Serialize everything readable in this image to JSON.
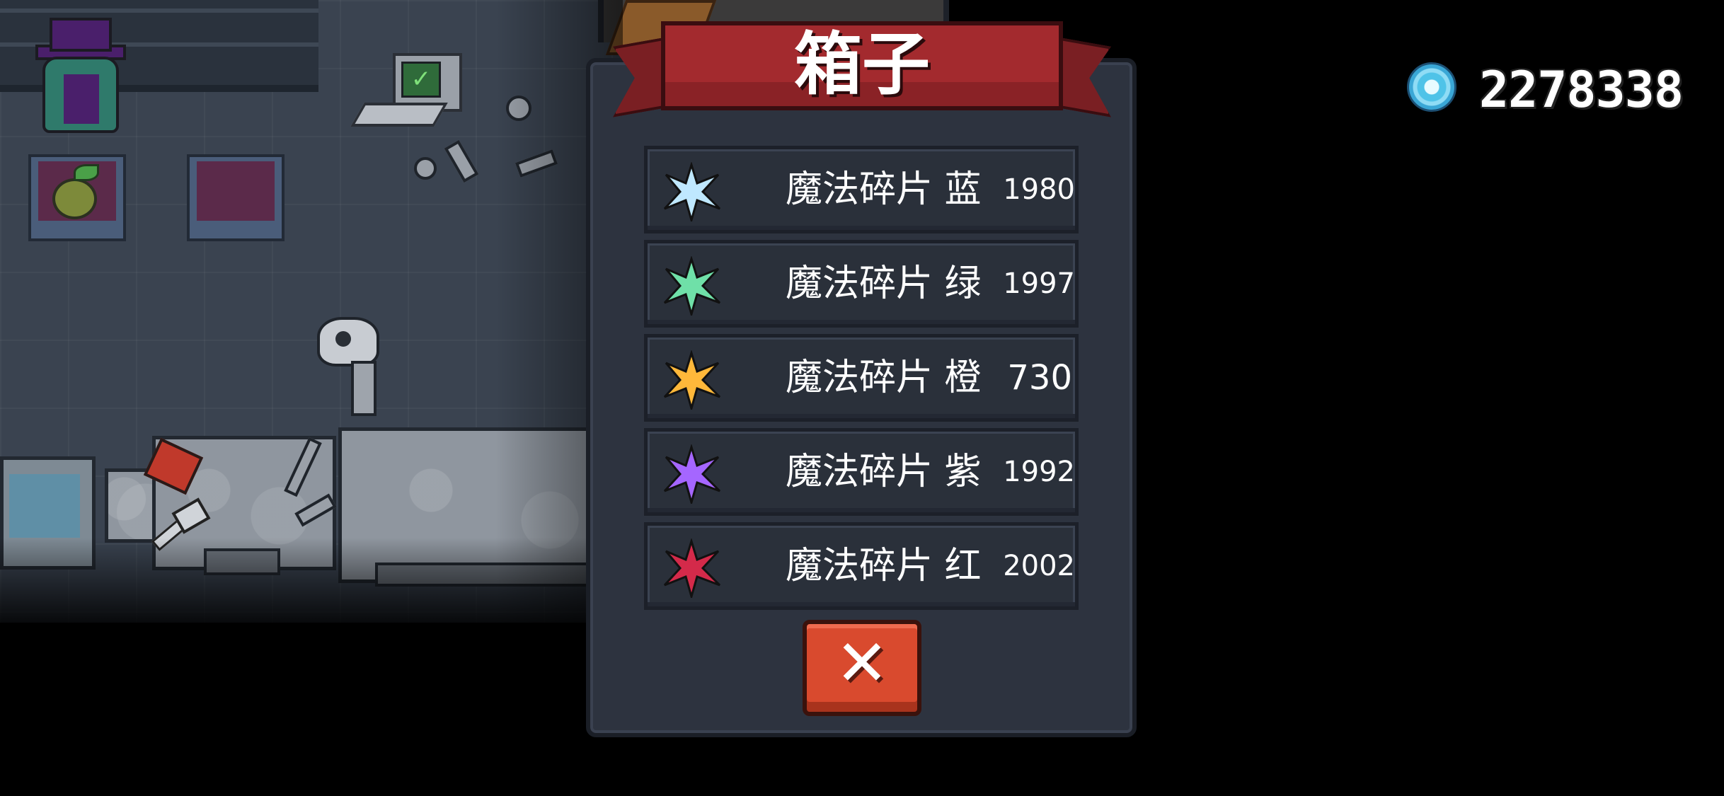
{
  "currency": {
    "icon": "gem-icon",
    "value": "2278338"
  },
  "dialog": {
    "title": "箱子",
    "items": [
      {
        "icon": "magic-shard-blue-icon",
        "name": "魔法碎片 蓝",
        "count": "1980",
        "color": "#bfe8ff"
      },
      {
        "icon": "magic-shard-green-icon",
        "name": "魔法碎片 绿",
        "count": "1997",
        "color": "#6fe0a8"
      },
      {
        "icon": "magic-shard-orange-icon",
        "name": "魔法碎片 橙",
        "count": "730",
        "color": "#ffb83a"
      },
      {
        "icon": "magic-shard-purple-icon",
        "name": "魔法碎片 紫",
        "count": "1992",
        "color": "#a566ff"
      },
      {
        "icon": "magic-shard-red-icon",
        "name": "魔法碎片 红",
        "count": "2002",
        "color": "#d42a4a"
      }
    ],
    "close_icon": "close-icon",
    "close_glyph": "✕"
  },
  "colors": {
    "panel": "#2d333f",
    "ribbon": "#a32a2e",
    "close_button": "#d94a2e"
  }
}
